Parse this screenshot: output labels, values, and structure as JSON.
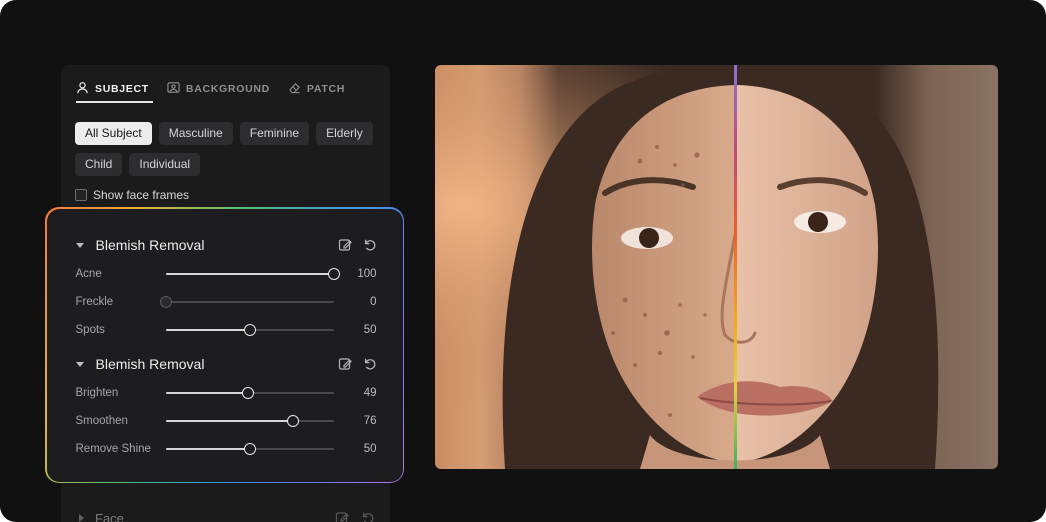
{
  "tabs": [
    {
      "label": "SUBJECT",
      "icon": "person-icon",
      "active": true
    },
    {
      "label": "BACKGROUND",
      "icon": "image-icon",
      "active": false
    },
    {
      "label": "PATCH",
      "icon": "eraser-icon",
      "active": false
    }
  ],
  "chips": [
    {
      "label": "All Subject",
      "active": true
    },
    {
      "label": "Masculine",
      "active": false
    },
    {
      "label": "Feminine",
      "active": false
    },
    {
      "label": "Elderly",
      "active": false
    },
    {
      "label": "Child",
      "active": false
    },
    {
      "label": "Individual",
      "active": false
    }
  ],
  "show_face_frames": {
    "label": "Show face frames",
    "checked": false
  },
  "sections": [
    {
      "title": "Blemish Removal",
      "sliders": [
        {
          "label": "Acne",
          "value": 100
        },
        {
          "label": "Freckle",
          "value": 0
        },
        {
          "label": "Spots",
          "value": 50
        }
      ]
    },
    {
      "title": "Blemish Removal",
      "sliders": [
        {
          "label": "Brighten",
          "value": 49
        },
        {
          "label": "Smoothen",
          "value": 76
        },
        {
          "label": "Remove Shine",
          "value": 50
        }
      ]
    }
  ],
  "collapsed_section": {
    "title": "Face"
  },
  "colors": {
    "background": "#111112",
    "panel": "#1b1b1c",
    "accent_gradient": [
      "#f07a3a",
      "#e7b13a",
      "#48c27a",
      "#3a9be3",
      "#b37ae6"
    ]
  }
}
